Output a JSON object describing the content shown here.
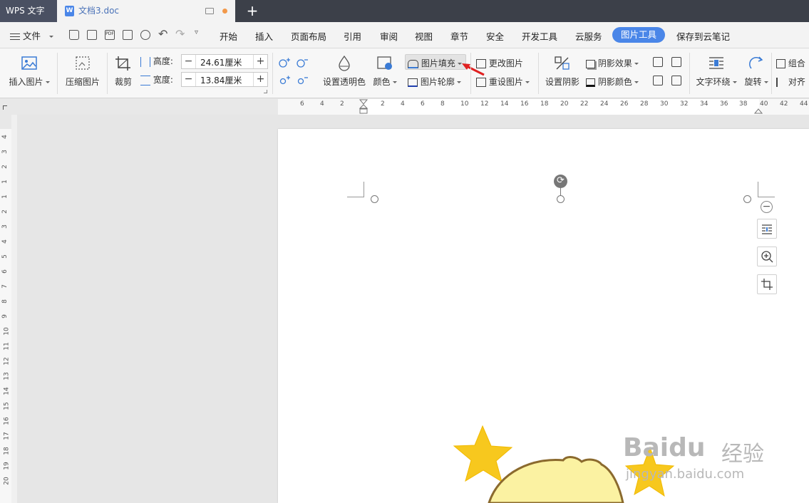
{
  "titlebar": {
    "app_name": "WPS 文字",
    "doc_tab": "文档3.doc",
    "new_tab": "+"
  },
  "menu": {
    "file": "文件",
    "tabs": [
      "开始",
      "插入",
      "页面布局",
      "引用",
      "审阅",
      "视图",
      "章节",
      "安全",
      "开发工具",
      "云服务"
    ],
    "active_tab": "图片工具",
    "save_cloud": "保存到云笔记"
  },
  "ribbon": {
    "insert_picture": "插入图片",
    "compress_picture": "压缩图片",
    "crop": "裁剪",
    "height_label": "高度:",
    "height_value": "24.61厘米",
    "width_label": "宽度:",
    "width_value": "13.84厘米",
    "set_transparent": "设置透明色",
    "color": "颜色",
    "picture_fill": "图片填充",
    "picture_outline": "图片轮廓",
    "change_picture": "更改图片",
    "reset_picture": "重设图片",
    "set_shadow": "设置阴影",
    "shadow_effect": "阴影效果",
    "shadow_color": "阴影颜色",
    "text_wrap": "文字环绕",
    "rotate": "旋转",
    "group": "组合",
    "align": "对齐"
  },
  "hruler_ticks": [
    "6",
    "4",
    "2",
    "2",
    "4",
    "6",
    "8",
    "10",
    "12",
    "14",
    "16",
    "18",
    "20",
    "22",
    "24",
    "26",
    "28",
    "30",
    "32",
    "34",
    "36",
    "38",
    "40",
    "42",
    "44"
  ],
  "vruler_ticks": [
    "4",
    "3",
    "2",
    "1",
    "1",
    "2",
    "3",
    "4",
    "5",
    "6",
    "7",
    "8",
    "9",
    "10",
    "11",
    "12",
    "13",
    "14",
    "15",
    "16",
    "17",
    "18",
    "19",
    "20"
  ],
  "watermark": {
    "brand": "Baidu",
    "brand_cn": "经验",
    "url": "jingyan.baidu.com"
  },
  "colors": {
    "accent": "#4a86e8",
    "titlebar": "#3c4049",
    "star": "#f7c81e",
    "arrow": "#e02020"
  }
}
